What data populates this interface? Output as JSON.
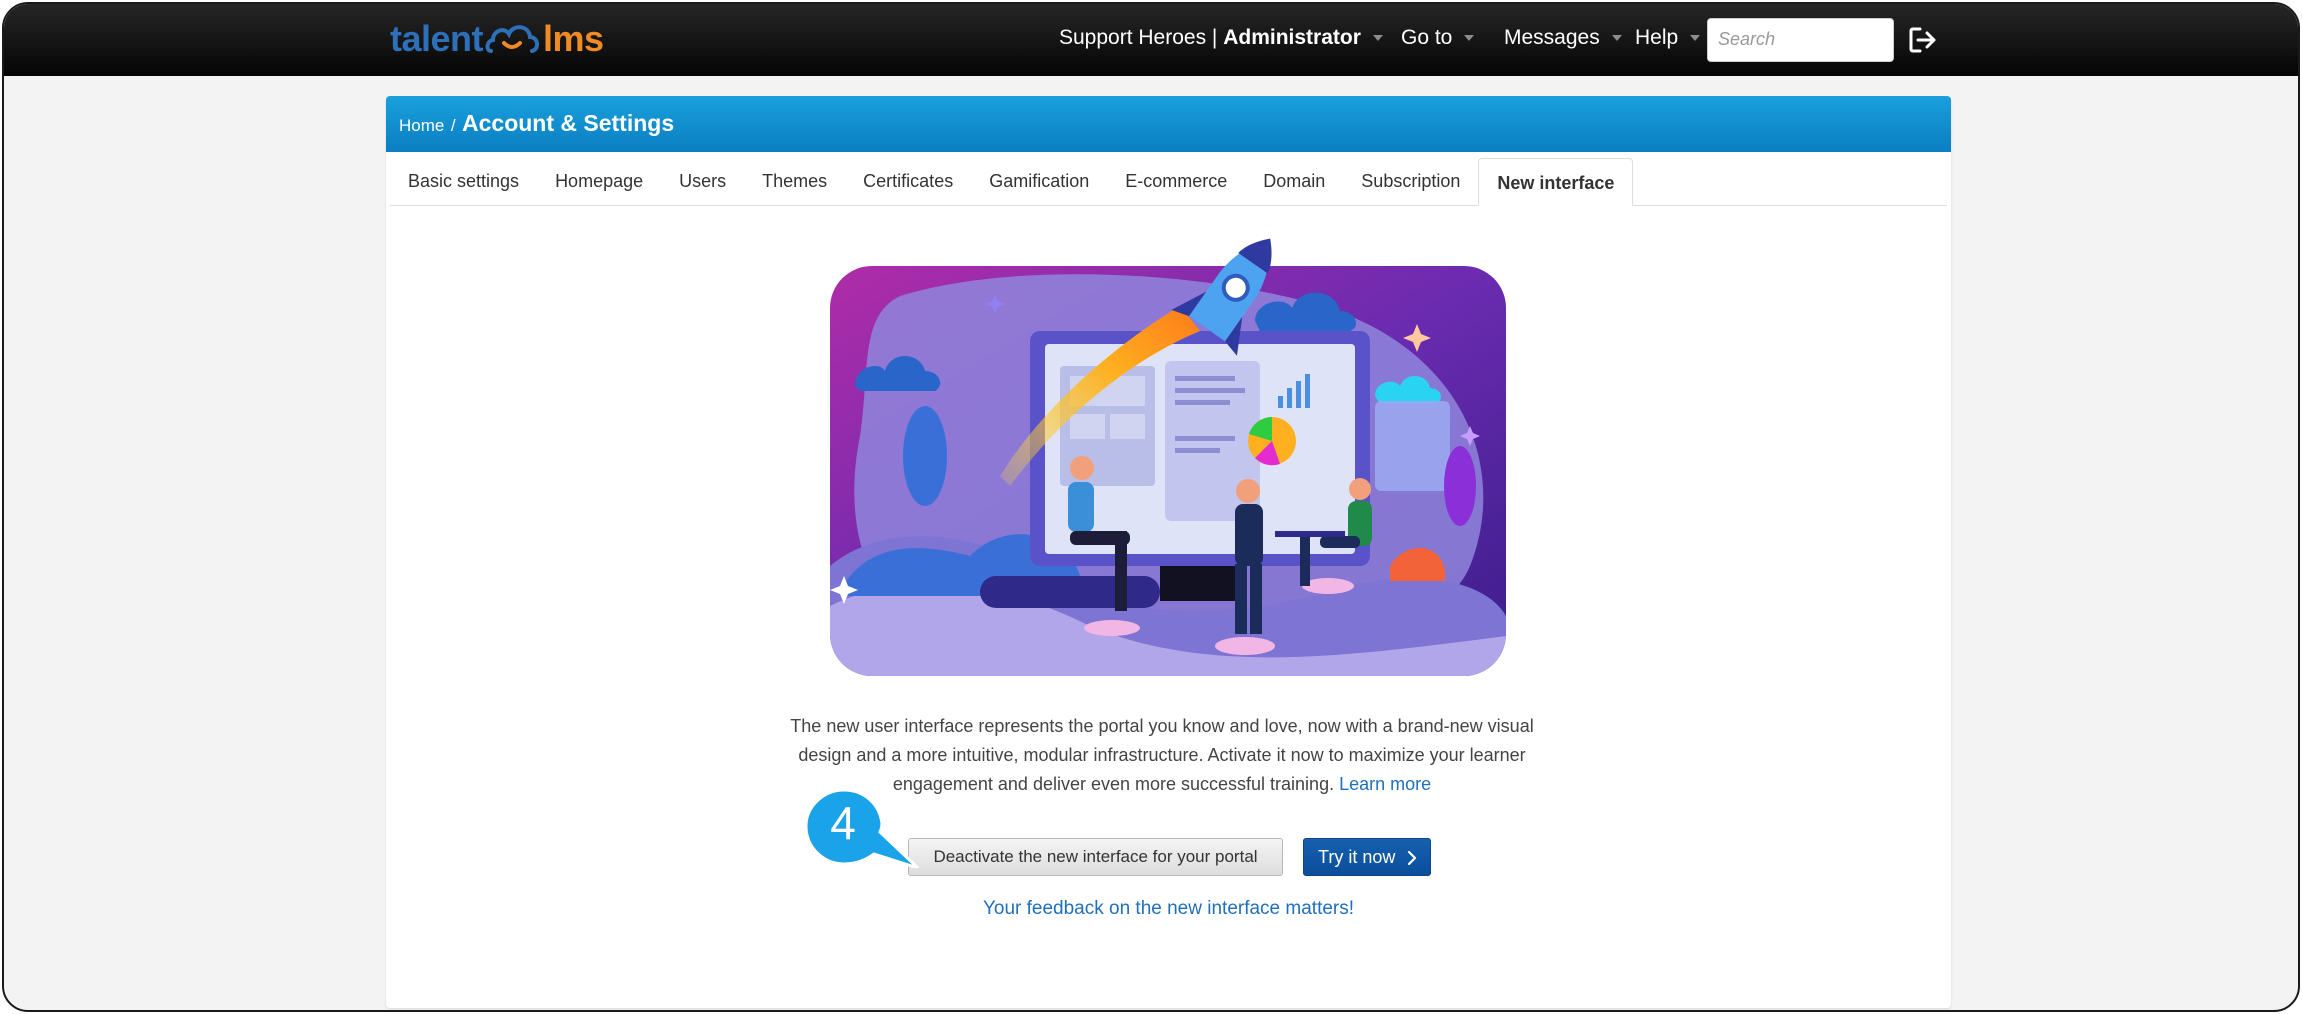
{
  "app": {
    "logo_left": "talent",
    "logo_right": "lms"
  },
  "topnav": {
    "user_prefix": "Support Heroes | ",
    "user_role": "Administrator",
    "goto": "Go to",
    "messages": "Messages",
    "help": "Help",
    "search_placeholder": "Search"
  },
  "breadcrumb": {
    "home": "Home",
    "separator": "/",
    "title": "Account & Settings"
  },
  "tabs": [
    {
      "label": "Basic settings"
    },
    {
      "label": "Homepage"
    },
    {
      "label": "Users"
    },
    {
      "label": "Themes"
    },
    {
      "label": "Certificates"
    },
    {
      "label": "Gamification"
    },
    {
      "label": "E-commerce"
    },
    {
      "label": "Domain"
    },
    {
      "label": "Subscription"
    },
    {
      "label": "New interface",
      "active": true
    }
  ],
  "content": {
    "description": "The new user interface represents the portal you know and love, now with a brand-new visual design and a more intuitive, modular infrastructure. Activate it now to maximize your learner engagement and deliver even more successful training.",
    "learn_more": "Learn more",
    "deactivate_button": "Deactivate the new interface for your portal",
    "try_button": "Try it now",
    "feedback_link": "Your feedback on the new interface matters!"
  },
  "annotation": {
    "step_number": "4"
  },
  "colors": {
    "header_blue": "#0a7ec2",
    "primary_button": "#0b4e9a",
    "link": "#1f6fbd",
    "callout": "#1aa3e8",
    "logo_blue": "#2d6fb8",
    "logo_orange": "#f08a24"
  },
  "icons": [
    "cloud-smile-logo-icon",
    "logout-icon",
    "chevron-right-icon",
    "caret-down-icon"
  ]
}
